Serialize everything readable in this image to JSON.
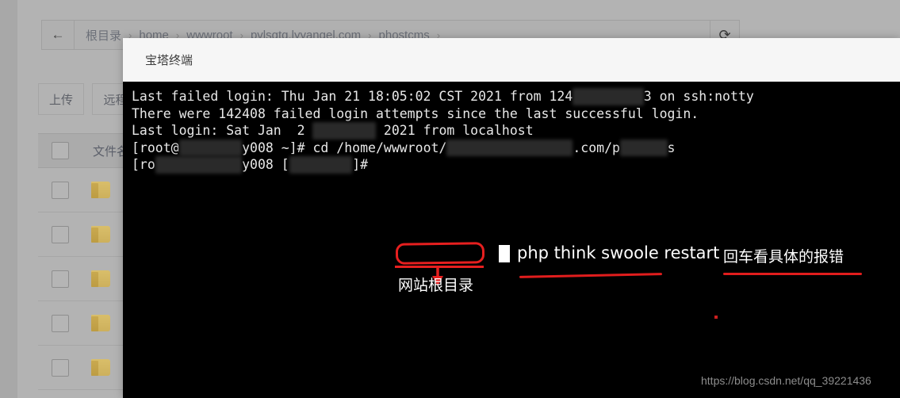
{
  "file_manager": {
    "back_icon": "←",
    "refresh_icon": "⟳",
    "breadcrumb": [
      {
        "label": "根目录"
      },
      {
        "label": "home"
      },
      {
        "label": "wwwroot"
      },
      {
        "label": "pvlsgtq.lyyangel.com"
      },
      {
        "label": "phostcms"
      }
    ],
    "breadcrumb_separator": "›",
    "buttons": {
      "upload": "上传",
      "remote": "远程下"
    },
    "table": {
      "header_filename": "文件名",
      "rows": [
        {
          "type": "folder"
        },
        {
          "type": "folder"
        },
        {
          "type": "folder"
        },
        {
          "type": "folder"
        },
        {
          "type": "folder"
        }
      ]
    }
  },
  "modal": {
    "title": "宝塔终端"
  },
  "terminal": {
    "lines": [
      {
        "segments": [
          {
            "text": "Last failed login: Thu Jan 21 18:05:02 CST 2021 from ",
            "blur": false
          },
          {
            "text": "124",
            "blur": false
          },
          {
            "text": ".xxx.xx.x",
            "blur": true
          },
          {
            "text": "3 on ssh:notty",
            "blur": false
          }
        ]
      },
      {
        "segments": [
          {
            "text": "There were 142408 failed login attempts since the last successful login.",
            "blur": false
          }
        ]
      },
      {
        "segments": [
          {
            "text": "Last login: Sat Jan  2 ",
            "blur": false
          },
          {
            "text": "16:05:46",
            "blur": true
          },
          {
            "text": " 2021 from localhost",
            "blur": false
          }
        ]
      },
      {
        "segments": [
          {
            "text": "[root@",
            "blur": false
          },
          {
            "text": "iZ2zegbm",
            "blur": true
          },
          {
            "text": "y008 ~]# cd /home/wwwroot/",
            "blur": false
          },
          {
            "text": "pvlsgtq.lyyangel",
            "blur": true
          },
          {
            "text": ".com/p",
            "blur": false
          },
          {
            "text": "hostcm",
            "blur": true
          },
          {
            "text": "s",
            "blur": false
          }
        ]
      },
      {
        "segments": [
          {
            "text": "[ro",
            "blur": false
          },
          {
            "text": "ot@iZ2zegbm",
            "blur": true
          },
          {
            "text": "y008 ",
            "blur": false
          },
          {
            "text": "[",
            "blur": false
          },
          {
            "text": "phostcms",
            "blur": true
          },
          {
            "text": "]# ",
            "blur": false
          }
        ]
      }
    ]
  },
  "annotations": {
    "command_hint": "php think swoole restart",
    "enter_hint": "回车看具体的报错",
    "root_dir_hint": "网站根目录",
    "accent_color": "#e61f1f"
  },
  "watermark": {
    "text": "https://blog.csdn.net/qq_39221436"
  }
}
